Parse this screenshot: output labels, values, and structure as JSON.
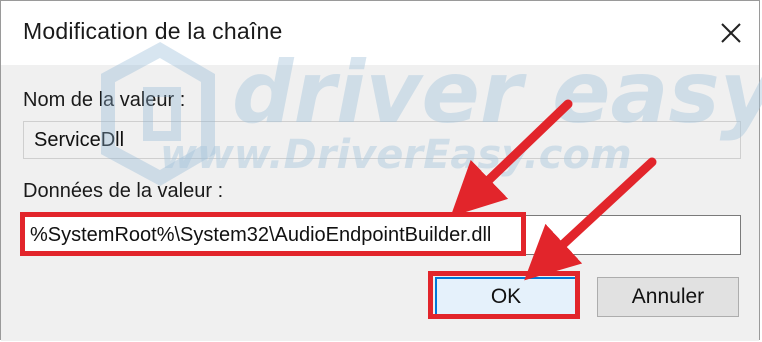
{
  "window": {
    "title": "Modification de la chaîne"
  },
  "value_name": {
    "label": "Nom de la valeur :",
    "value": "ServiceDll"
  },
  "value_data": {
    "label": "Données de la valeur :",
    "value": "%SystemRoot%\\System32\\AudioEndpointBuilder.dll"
  },
  "buttons": {
    "ok_label": "OK",
    "cancel_label": "Annuler"
  },
  "watermark": {
    "brand": "driver easy",
    "url": "www.DriverEasy.com"
  },
  "colors": {
    "highlight": "#e2252b",
    "ok_border": "#0078d7",
    "dialog_body": "#f0f0f0"
  },
  "icons": {
    "close": "close-icon",
    "watermark_logo": "driver-easy-logo-icon",
    "arrows": "red-arrow-icon"
  }
}
